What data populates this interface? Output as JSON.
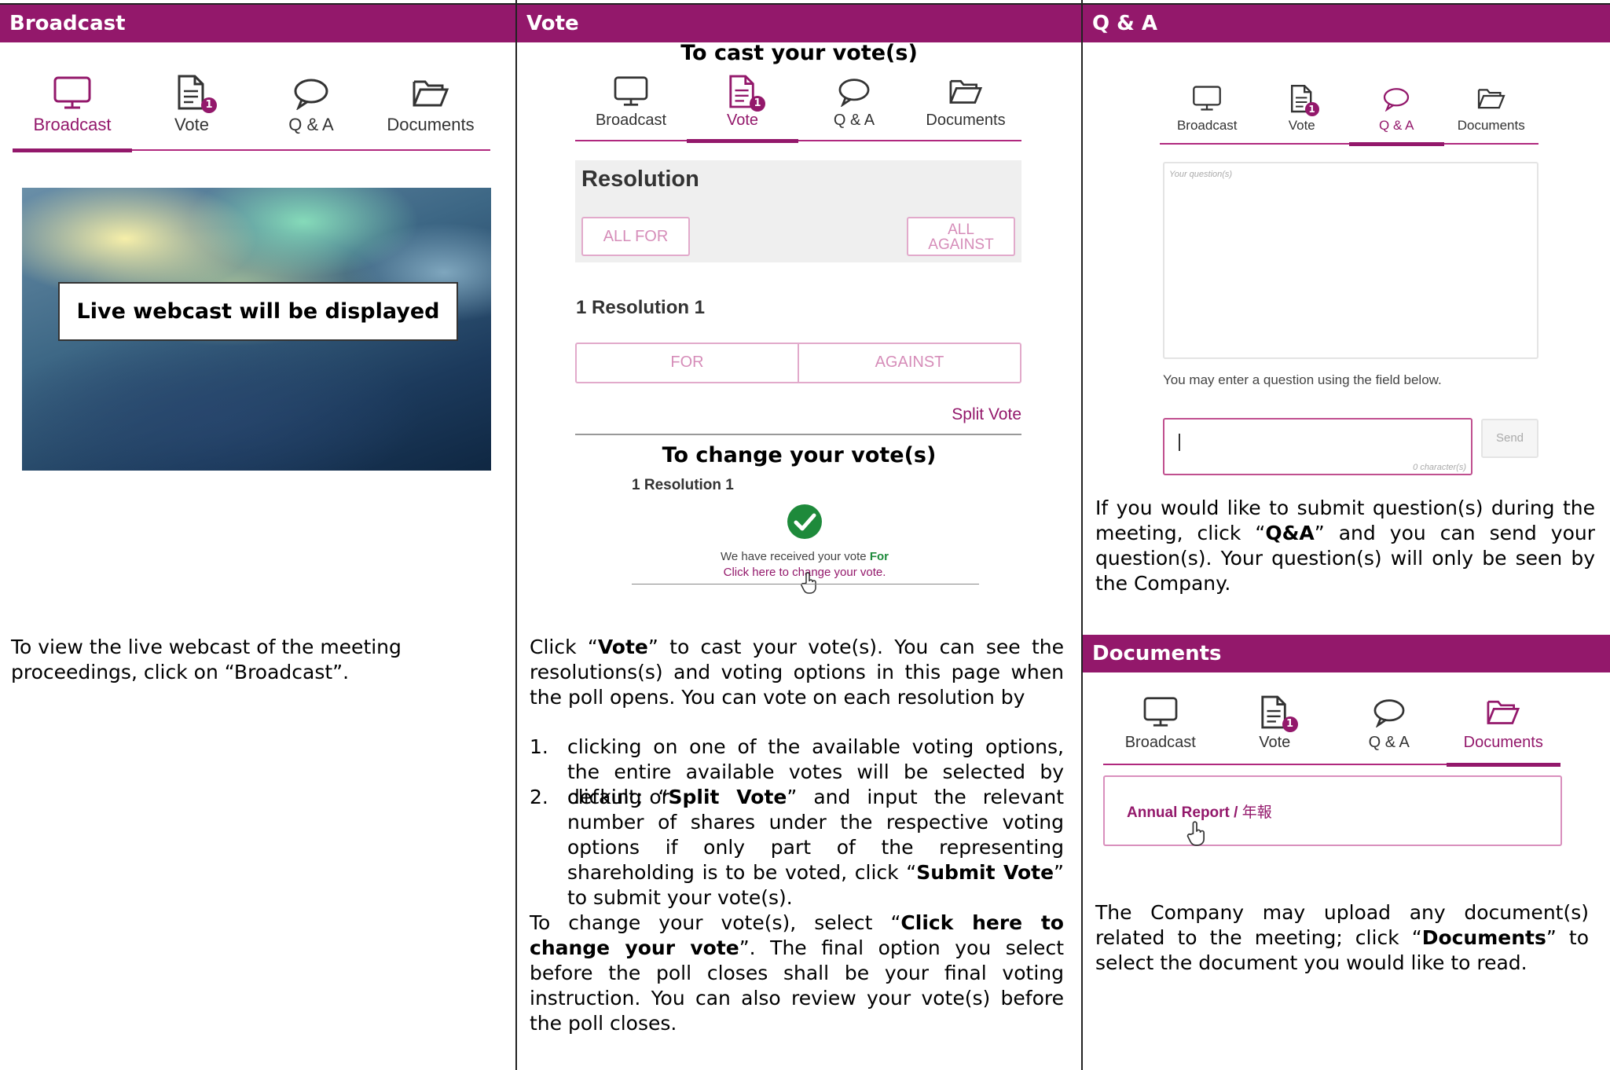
{
  "headers": {
    "broadcast": "Broadcast",
    "vote": "Vote",
    "qa": "Q & A",
    "documents": "Documents"
  },
  "nav": {
    "broadcast": "Broadcast",
    "vote": "Vote",
    "qa": "Q & A",
    "documents": "Documents",
    "vote_badge": "1"
  },
  "broadcast_panel": {
    "webcast_label": "Live webcast will be displayed",
    "instruction": "To view the live webcast of the meeting proceedings, click on “Broadcast”."
  },
  "vote_panel": {
    "cast_title": "To cast your vote(s)",
    "resolution_heading": "Resolution",
    "all_for": "ALL FOR",
    "all_against": "ALL AGAINST",
    "resolution_item": "1 Resolution 1",
    "for": "FOR",
    "against": "AGAINST",
    "split_vote": "Split Vote",
    "change_title": "To change your vote(s)",
    "change_resolution": "1 Resolution 1",
    "received_text": "We have received your vote",
    "received_value": "For",
    "change_link": "Click here to change your vote.",
    "p1_a": "Click “",
    "p1_b": "Vote",
    "p1_c": "” to cast your vote(s). You can see the resolutions(s) and voting options in this page when the poll opens. You can vote on each resolution by",
    "li1_num": "1.",
    "li1": "clicking on one of the available voting options, the entire available votes will be selected by default; or",
    "li2_num": "2.",
    "li2_a": "clicking “",
    "li2_b": "Split Vote",
    "li2_c": "” and input the relevant number of shares under the respective voting options if only part of the representing shareholding is to be voted, click “",
    "li2_d": "Submit Vote",
    "li2_e": "” to submit your vote(s).",
    "p2_a": "To change your vote(s), select “",
    "p2_b": "Click here to change your vote",
    "p2_c": "”. The final option you select before the poll closes shall be your final voting instruction. You can also review your vote(s) before the poll closes."
  },
  "qa_panel": {
    "question_placeholder": "Your question(s)",
    "hint": "You may enter a question using the field below.",
    "send": "Send",
    "char_count": "0 character(s)",
    "p_a": "If you would like to submit question(s) during the meeting, click “",
    "p_b": "Q&A",
    "p_c": "” and you can send your question(s). Your question(s) will only be seen by the Company."
  },
  "documents_panel": {
    "doc_en": "Annual Report",
    "doc_sep": " / ",
    "doc_zh": "年報",
    "p_a": "The Company may upload any document(s) related to the meeting; click “",
    "p_b": "Documents",
    "p_c": "” to select the document you would like to read."
  },
  "colors": {
    "brand": "#93186b",
    "success": "#1e8a3b",
    "border_light": "#e2aacb"
  },
  "icons": [
    "monitor-icon",
    "document-icon",
    "speech-bubble-icon",
    "folder-icon",
    "check-circle-icon",
    "hand-pointer-icon"
  ]
}
